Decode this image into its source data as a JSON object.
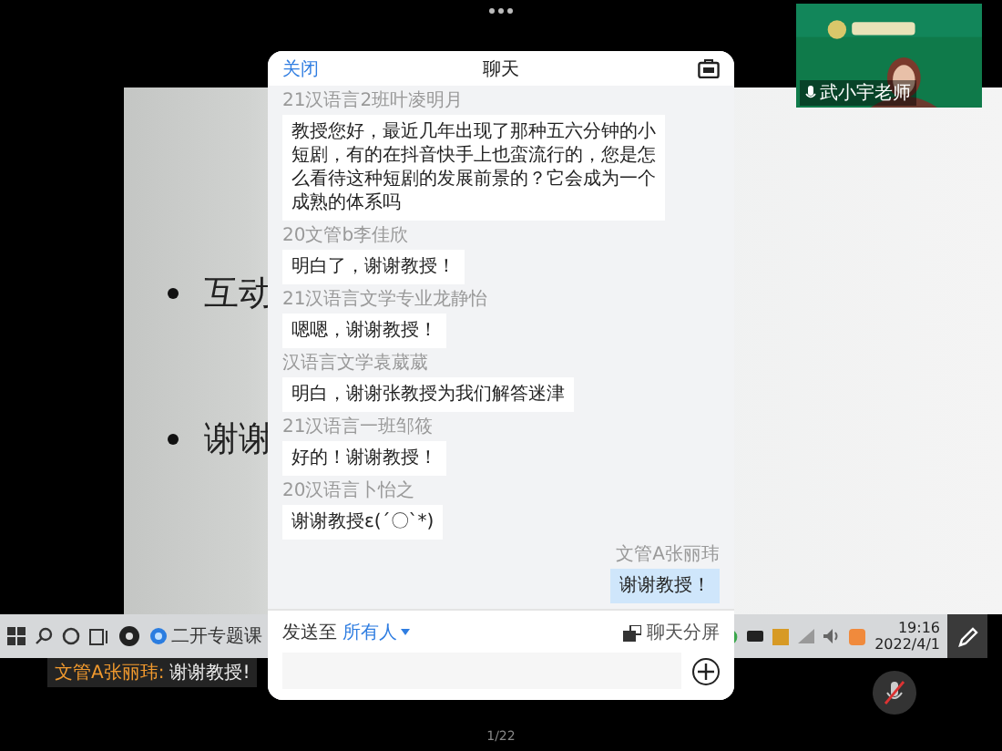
{
  "slide": {
    "bullets": [
      "互动",
      "谢谢"
    ]
  },
  "taskbar": {
    "app_label": "二开专题课",
    "time": "19:16",
    "date": "2022/4/1"
  },
  "notification": {
    "sender": "文管A张丽玮:",
    "text": "谢谢教授!"
  },
  "video": {
    "name": "武小宇老师"
  },
  "page_indicator": "1/22",
  "chat": {
    "close": "关闭",
    "title": "聊天",
    "messages": [
      {
        "sender": "21汉语言2班叶凌明月",
        "text": "教授您好，最近几年出现了那种五六分钟的小短剧，有的在抖音快手上也蛮流行的，您是怎么看待这种短剧的发展前景的？它会成为一个成熟的体系吗",
        "mine": false
      },
      {
        "sender": "20文管b李佳欣",
        "text": "明白了，谢谢教授！",
        "mine": false
      },
      {
        "sender": "21汉语言文学专业龙静怡",
        "text": "嗯嗯，谢谢教授！",
        "mine": false
      },
      {
        "sender": "汉语言文学袁葳葳",
        "text": "明白，谢谢张教授为我们解答迷津",
        "mine": false
      },
      {
        "sender": "21汉语言一班邹筱",
        "text": "好的！谢谢教授！",
        "mine": false
      },
      {
        "sender": "20汉语言卜怡之",
        "text": "谢谢教授ε(´〇`*)",
        "mine": false
      },
      {
        "sender": "文管A张丽玮",
        "text": "谢谢教授！",
        "mine": true
      }
    ],
    "send_to_label": "发送至",
    "recipient": "所有人",
    "split_label": "聊天分屏"
  }
}
